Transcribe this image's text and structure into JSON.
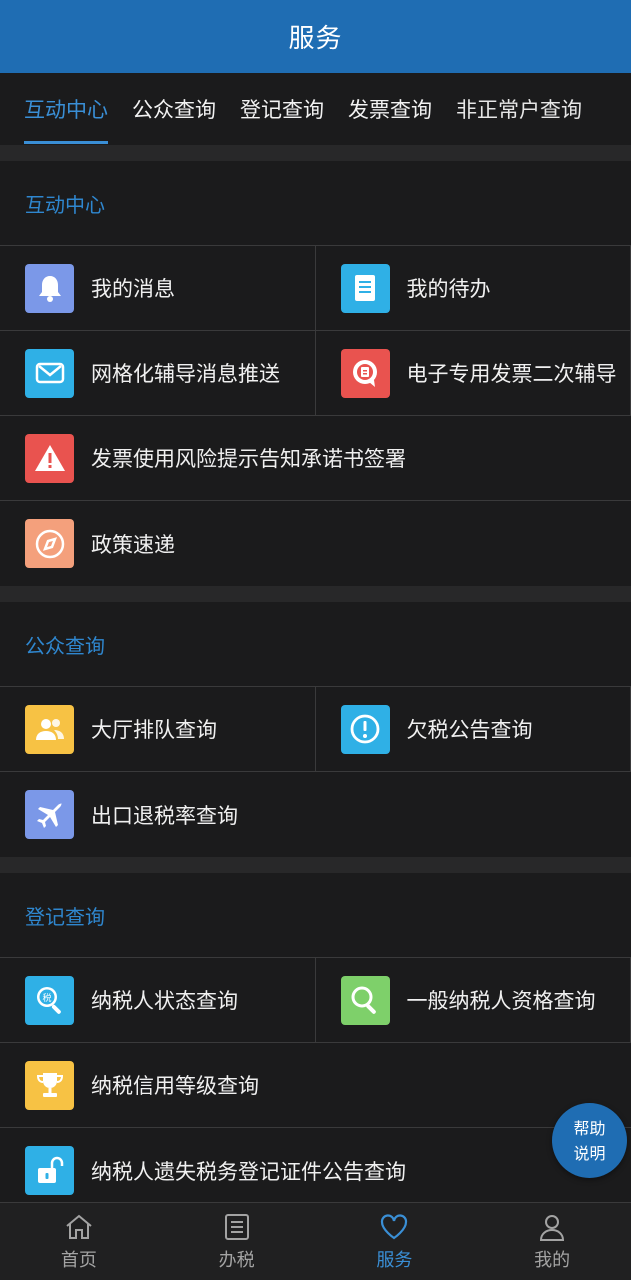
{
  "header": {
    "title": "服务"
  },
  "tabs": [
    {
      "label": "互动中心",
      "active": true
    },
    {
      "label": "公众查询"
    },
    {
      "label": "登记查询"
    },
    {
      "label": "发票查询"
    },
    {
      "label": "非正常户查询"
    }
  ],
  "sections": {
    "interaction": {
      "title": "互动中心",
      "items": {
        "messages": "我的消息",
        "todo": "我的待办",
        "grid_push": "网格化辅导消息推送",
        "e_invoice": "电子专用发票二次辅导",
        "invoice_risk": "发票使用风险提示告知承诺书签署",
        "policy": "政策速递"
      }
    },
    "public": {
      "title": "公众查询",
      "items": {
        "queue": "大厅排队查询",
        "arrears": "欠税公告查询",
        "export_rebate": "出口退税率查询"
      }
    },
    "registration": {
      "title": "登记查询",
      "items": {
        "taxpayer_status": "纳税人状态查询",
        "general_taxpayer": "一般纳税人资格查询",
        "credit_level": "纳税信用等级查询",
        "lost_certificate": "纳税人遗失税务登记证件公告查询"
      }
    }
  },
  "help": {
    "line1": "帮助",
    "line2": "说明"
  },
  "bottom_nav": {
    "home": "首页",
    "tax": "办税",
    "service": "服务",
    "mine": "我的"
  },
  "colors": {
    "header": "#1f6db3",
    "accent": "#3a8fd6",
    "background": "#1b1b1c",
    "icon_blue": "#5b8ce6",
    "icon_cyan": "#2fa7e0",
    "icon_red": "#e9534f",
    "icon_peach": "#f4a07c",
    "icon_yellow": "#f7c244",
    "icon_green": "#7ed06a"
  }
}
